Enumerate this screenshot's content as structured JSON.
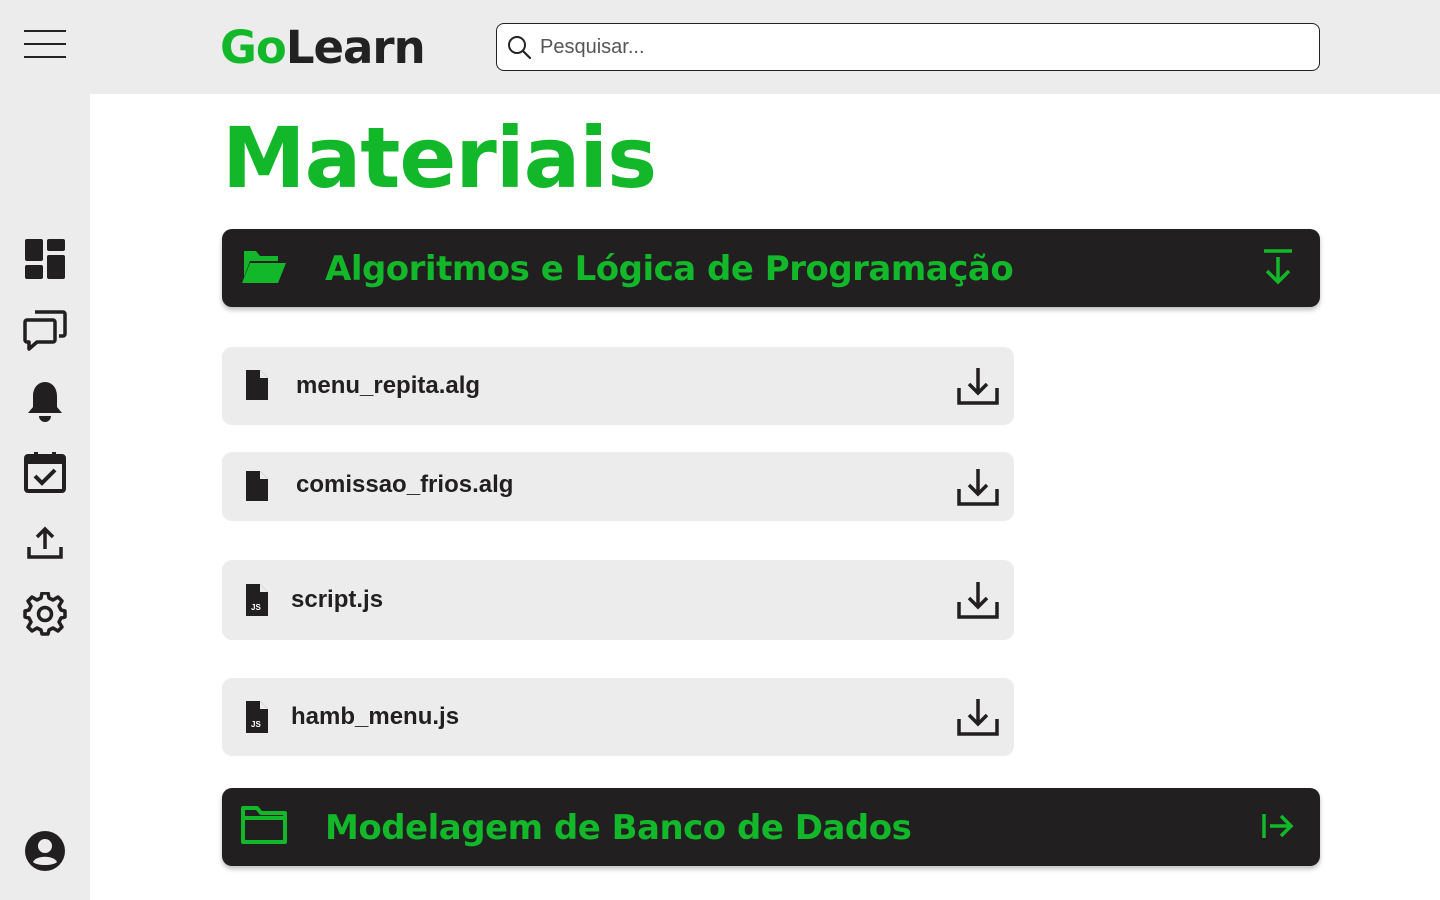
{
  "app": {
    "logo_go": "Go",
    "logo_learn": "Learn",
    "brand_color": "#12b829",
    "dark_color": "#221f20"
  },
  "search": {
    "placeholder": "Pesquisar...",
    "value": ""
  },
  "sidebar": {
    "items": [
      {
        "icon": "dashboard-icon"
      },
      {
        "icon": "chat-icon"
      },
      {
        "icon": "bell-icon"
      },
      {
        "icon": "calendar-check-icon"
      },
      {
        "icon": "upload-icon"
      },
      {
        "icon": "gear-icon"
      }
    ],
    "profile_icon": "user-avatar-icon"
  },
  "main": {
    "title": "Materiais",
    "folders": [
      {
        "name": "Algoritmos e Lógica de Programação",
        "state": "expanded",
        "icon": "folder-open-icon",
        "action_icon": "collapse-down-icon",
        "files": [
          {
            "name": "menu_repita.alg",
            "icon": "file-icon",
            "action_icon": "download-icon"
          },
          {
            "name": "comissao_frios.alg",
            "icon": "file-icon",
            "action_icon": "download-icon"
          },
          {
            "name": "script.js",
            "icon": "js-file-icon",
            "action_icon": "download-icon"
          },
          {
            "name": "hamb_menu.js",
            "icon": "js-file-icon",
            "action_icon": "download-icon"
          }
        ]
      },
      {
        "name": "Modelagem de Banco de Dados",
        "state": "collapsed",
        "icon": "folder-icon",
        "action_icon": "expand-right-icon",
        "files": []
      }
    ]
  }
}
